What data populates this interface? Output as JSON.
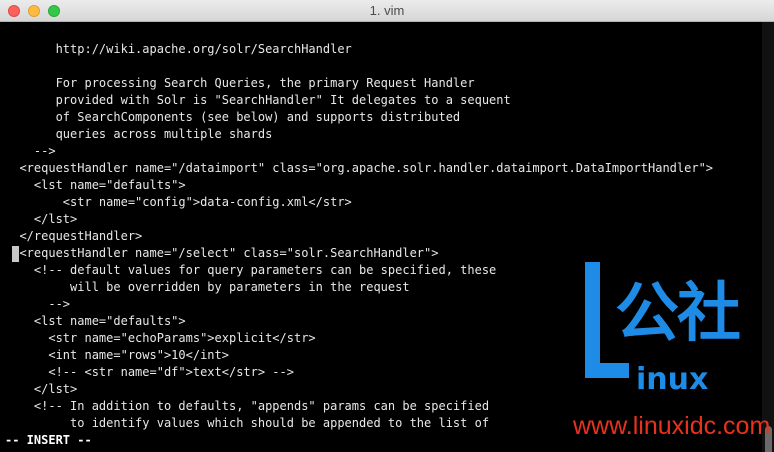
{
  "window": {
    "title": "1. vim"
  },
  "editor": {
    "lines": [
      "       http://wiki.apache.org/solr/SearchHandler",
      "",
      "       For processing Search Queries, the primary Request Handler",
      "       provided with Solr is \"SearchHandler\" It delegates to a sequent",
      "       of SearchComponents (see below) and supports distributed",
      "       queries across multiple shards",
      "    -->",
      "  <requestHandler name=\"/dataimport\" class=\"org.apache.solr.handler.dataimport.DataImportHandler\">",
      "    <lst name=\"defaults\">",
      "        <str name=\"config\">data-config.xml</str>",
      "    </lst>",
      "  </requestHandler>",
      "  <requestHandler name=\"/select\" class=\"solr.SearchHandler\">",
      "    <!-- default values for query parameters can be specified, these",
      "         will be overridden by parameters in the request",
      "      -->",
      "    <lst name=\"defaults\">",
      "      <str name=\"echoParams\">explicit</str>",
      "      <int name=\"rows\">10</int>",
      "      <!-- <str name=\"df\">text</str> -->",
      "    </lst>",
      "    <!-- In addition to defaults, \"appends\" params can be specified",
      "         to identify values which should be appended to the list of"
    ],
    "mode": "-- INSERT --"
  },
  "watermark": {
    "chinese": "公社",
    "inux": "inux",
    "url": "www.linuxidc.com",
    "brand_color": "#1e8be6",
    "url_color": "#e8321d"
  }
}
